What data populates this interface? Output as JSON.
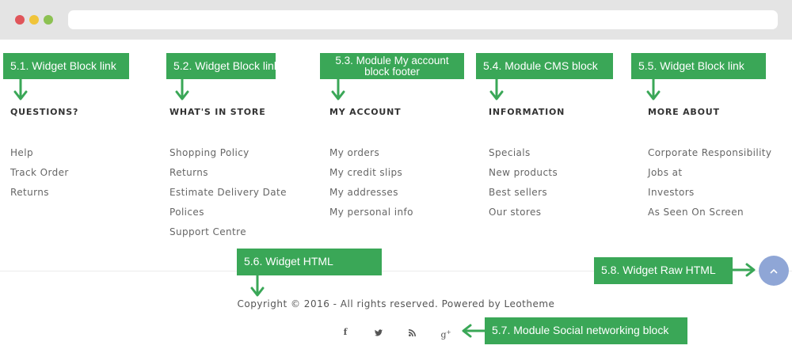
{
  "footer": {
    "columns": [
      {
        "title": "QUESTIONS?",
        "links": [
          "Help",
          "Track Order",
          "Returns"
        ]
      },
      {
        "title": "WHAT'S IN STORE",
        "links": [
          "Shopping Policy",
          "Returns",
          "Estimate Delivery Date",
          "Polices",
          "Support Centre"
        ]
      },
      {
        "title": "MY ACCOUNT",
        "links": [
          "My orders",
          "My credit slips",
          "My addresses",
          "My personal info"
        ]
      },
      {
        "title": "INFORMATION",
        "links": [
          "Specials",
          "New products",
          "Best sellers",
          "Our stores"
        ]
      },
      {
        "title": "MORE ABOUT",
        "links": [
          "Corporate Responsibility",
          "Jobs at",
          "Investors",
          "As Seen On Screen"
        ]
      }
    ],
    "copyright": "Copyright © 2016 - All rights reserved. Powered by Leotheme",
    "social_icons": [
      "facebook-icon",
      "twitter-icon",
      "rss-icon",
      "google-plus-icon"
    ],
    "back_to_top_icon": "chevron-up-icon"
  },
  "annotations": {
    "l51": "5.1. Widget Block link",
    "l52": "5.2. Widget Block link",
    "l53_line1": "5.3. Module My account",
    "l53_line2": "block footer",
    "l54": "5.4. Module CMS block",
    "l55": "5.5. Widget Block link",
    "l56": "5.6. Widget HTML",
    "l57": "5.7. Module Social networking block",
    "l58": "5.8. Widget Raw HTML"
  },
  "colors": {
    "annotation_green": "#3aa757",
    "back_to_top": "#8fa6d6",
    "chrome": "#e4e4e4"
  }
}
